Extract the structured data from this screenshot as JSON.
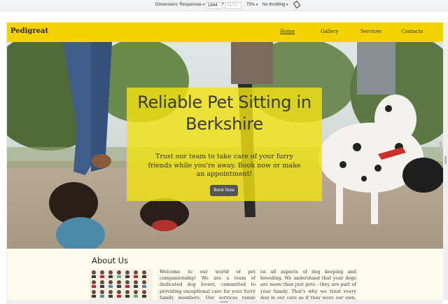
{
  "devtools": {
    "dimensions_label": "Dimensions: Responsive",
    "width": "1844",
    "height_placeholder": "1170",
    "zoom": "75%",
    "throttling": "No throttling",
    "times": "×"
  },
  "site": {
    "brand": "Pedigreat",
    "nav": [
      {
        "label": "Home",
        "active": true
      },
      {
        "label": "Gallery",
        "active": false
      },
      {
        "label": "Services",
        "active": false
      },
      {
        "label": "Contacts",
        "active": false
      }
    ]
  },
  "hero": {
    "title_line1": "Reliable Pet Sitting in",
    "title_line2": "Berkshire",
    "subtitle": "Trust our team to take care of your furry friends while you're away. Book now or make an appointment!",
    "cta": "Book Now"
  },
  "about": {
    "title": "About Us",
    "col1": "Welcome to our world of pet companionship! We are a team of dedicated dog lovers, committed to providing exceptional care for your furry family members. Our services range from",
    "col2": "on all aspects of dog keeping and breeding. We understand that your dogs are more than just pets - they are part of your family. That's why we treat every dog in our care as if they were our own, providing them with"
  },
  "colors": {
    "nav_bg": "#f4d400",
    "hero_box": "#f0e214",
    "button": "#555555",
    "page_bg": "#fffcef"
  }
}
